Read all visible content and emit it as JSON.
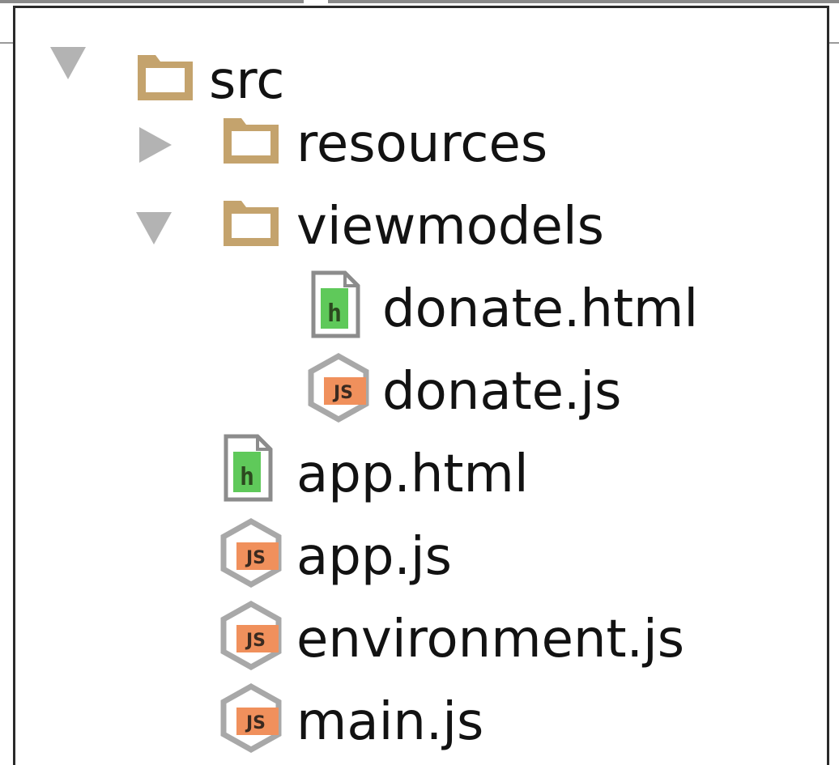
{
  "tree": {
    "root": {
      "name": "src",
      "expanded": true,
      "icon": "folder-icon"
    },
    "children": [
      {
        "name": "resources",
        "type": "folder",
        "expanded": false,
        "icon": "folder-icon"
      },
      {
        "name": "viewmodels",
        "type": "folder",
        "expanded": true,
        "icon": "folder-icon",
        "children": [
          {
            "name": "donate.html",
            "type": "file",
            "icon": "html-file-icon"
          },
          {
            "name": "donate.js",
            "type": "file",
            "icon": "js-file-icon"
          }
        ]
      },
      {
        "name": "app.html",
        "type": "file",
        "icon": "html-file-icon"
      },
      {
        "name": "app.js",
        "type": "file",
        "icon": "js-file-icon"
      },
      {
        "name": "environment.js",
        "type": "file",
        "icon": "js-file-icon"
      },
      {
        "name": "main.js",
        "type": "file",
        "icon": "js-file-icon"
      }
    ]
  },
  "colors": {
    "folder": "#c4a36d",
    "chevron": "#b3b3b3",
    "html_badge": "#5fc95a",
    "js_badge": "#f0905c",
    "js_hex": "#a8a8a8",
    "text": "#121212"
  }
}
